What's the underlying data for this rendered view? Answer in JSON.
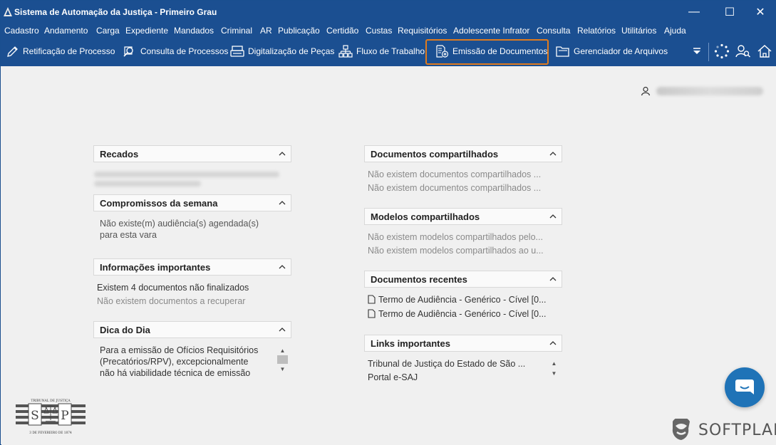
{
  "window": {
    "title": "Sistema de Automação da Justiça - Primeiro Grau",
    "controls": {
      "minimize": "—",
      "maximize": "☐",
      "close": "✕"
    }
  },
  "menu": [
    "Cadastro",
    "Andamento",
    "Carga",
    "Expediente",
    "Mandados",
    "Criminal",
    "AR",
    "Publicação",
    "Certidão",
    "Custas",
    "Requisitórios",
    "Adolescente Infrator",
    "Consulta",
    "Relatórios",
    "Utilitários",
    "Ajuda"
  ],
  "toolbar": {
    "items": [
      {
        "label": "Retificação de Processo",
        "icon": "pencil-icon"
      },
      {
        "label": "Consulta de Processos",
        "icon": "magnifier-icon"
      },
      {
        "label": "Digitalização de Peças",
        "icon": "scanner-icon"
      },
      {
        "label": "Fluxo de Trabalho",
        "icon": "workflow-icon"
      },
      {
        "label": "Emissão de Documentos",
        "icon": "document-add-icon",
        "highlighted": true
      },
      {
        "label": "Gerenciador de Arquivos",
        "icon": "folder-icon"
      }
    ],
    "highlight_color": "#e07b1e"
  },
  "colors": {
    "titlebar": "#1b4f91",
    "background": "#f0f0f0",
    "chat": "#1f73b7"
  },
  "left_panels": {
    "recados": {
      "title": "Recados"
    },
    "compromissos": {
      "title": "Compromissos da semana",
      "lines": [
        "Não existe(m) audiência(s) agendada(s)",
        "para esta vara"
      ]
    },
    "informacoes": {
      "title": "Informações importantes",
      "line1": "Existem 4 documentos não finalizados",
      "line2": "Não existem documentos a recuperar"
    },
    "dica": {
      "title": "Dica do Dia",
      "lines": [
        "Para a emissão de Ofícios Requisitórios",
        "(Precatórios/RPV), excepcionalmente",
        "não há viabilidade técnica de emissão"
      ]
    }
  },
  "right_panels": {
    "docs_compartilhados": {
      "title": "Documentos compartilhados",
      "lines": [
        "Não existem documentos compartilhados ...",
        "Não existem documentos compartilhados ..."
      ]
    },
    "modelos": {
      "title": "Modelos compartilhados",
      "lines": [
        "Não existem modelos compartilhados pelo...",
        "Não existem modelos compartilhados ao u..."
      ]
    },
    "recentes": {
      "title": "Documentos recentes",
      "lines": [
        "Termo de Audiência - Genérico - Cível [0...",
        "Termo de Audiência - Genérico - Cível [0..."
      ]
    },
    "links": {
      "title": "Links importantes",
      "lines": [
        "Tribunal de Justiça do Estado de São ...",
        "Portal e-SAJ"
      ]
    }
  },
  "logo": {
    "top": "TRIBUNAL DE JUSTIÇA",
    "s": "S",
    "p": "P",
    "bottom": "3 DE FEVEREIRO DE 1874"
  },
  "brand": "SOFTPLAN"
}
